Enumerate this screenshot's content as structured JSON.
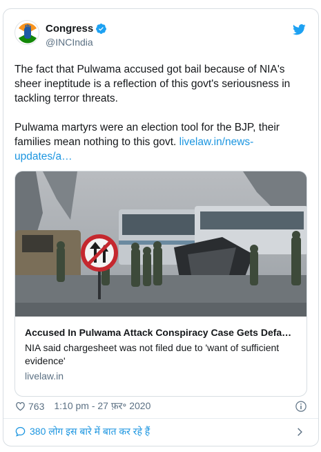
{
  "tweet": {
    "author_name": "Congress",
    "author_handle": "@INCIndia",
    "paragraph_1": "The fact that Pulwama accused got bail because of NIA's sheer ineptitude is a reflection of this govt's seriousness in tackling terror threats.",
    "paragraph_2_text": "Pulwama martyrs were an election tool for the BJP, their families mean nothing to this govt. ",
    "paragraph_2_link": "livelaw.in/news-updates/a…",
    "likes": "763",
    "timestamp": "1:10 pm - 27 फ़र॰ 2020",
    "replies_text": "380 लोग इस बारे में बात कर रहे हैं"
  },
  "card": {
    "title": "Accused In Pulwama Attack Conspiracy Case Gets Defa…",
    "description": "NIA said chargesheet was not filed due to 'want of sufficient evidence'",
    "domain": "livelaw.in"
  },
  "colors": {
    "link": "#1b95e0",
    "verified": "#1da1f2",
    "muted": "#5b7083",
    "congress_saffron": "#f7931e",
    "congress_green": "#138808"
  },
  "icons": [
    "congress-logo-icon",
    "verified-badge-icon",
    "twitter-bird-icon",
    "heart-icon",
    "info-icon",
    "speech-bubble-icon",
    "chevron-right-icon"
  ]
}
